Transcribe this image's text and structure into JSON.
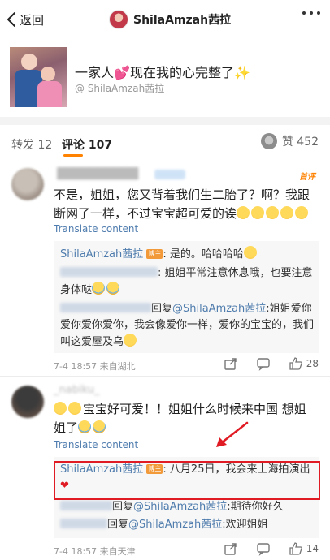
{
  "nav": {
    "back_label": "返回",
    "title": "ShilaAmzah茜拉"
  },
  "post": {
    "text_prefix": "一家人",
    "text_middle": "现在我的心完整了",
    "author": "@ ShilaAmzah茜拉"
  },
  "tabs": {
    "forward_label": "转发",
    "forward_count": "12",
    "comments_label": "评论",
    "comments_count": "107",
    "likes_label": "赞 452"
  },
  "comments": [
    {
      "first_badge": "首评",
      "text": "不是，姐姐，您又背着我们生二胎了？啊？我跟断网了一样，不过宝宝超可爱的诶",
      "translate": "Translate content",
      "replies": {
        "r1_name": "ShilaAmzah茜拉",
        "r1_badge": "博主",
        "r1_text": ": 是的。哈哈哈哈",
        "r2_text": ": 姐姐平常注意休息哦，也要注意身体哒",
        "r3_text": "回复",
        "r3_mention": "@ShilaAmzah茜拉",
        "r3_rest": ":姐姐爱你爱你爱你爱你，我会像爱你一样，爱你的宝宝的，我们叫这爱屋及乌"
      },
      "meta": "7-4 18:57 来自湖北",
      "likes": "28"
    },
    {
      "name_blur": "_nabiku_",
      "text": "宝宝好可爱！！姐姐什么时候来中国 想姐姐了",
      "translate": "Translate content",
      "replies": {
        "r1_name": "ShilaAmzah茜拉",
        "r1_badge": "博主",
        "r1_text": ": 八月25日，我会来上海拍演出",
        "r2_text": "回复",
        "r2_mention": "@ShilaAmzah茜拉",
        "r2_rest": ":期待你好久",
        "r3_text": "回复",
        "r3_mention": "@ShilaAmzah茜拉",
        "r3_rest": ":欢迎姐姐"
      },
      "meta": "7-4 18:57 来自天津",
      "likes": "14"
    }
  ],
  "colors": {
    "accent": "#ff8200",
    "link": "#507daf",
    "highlight": "#e01b24"
  }
}
